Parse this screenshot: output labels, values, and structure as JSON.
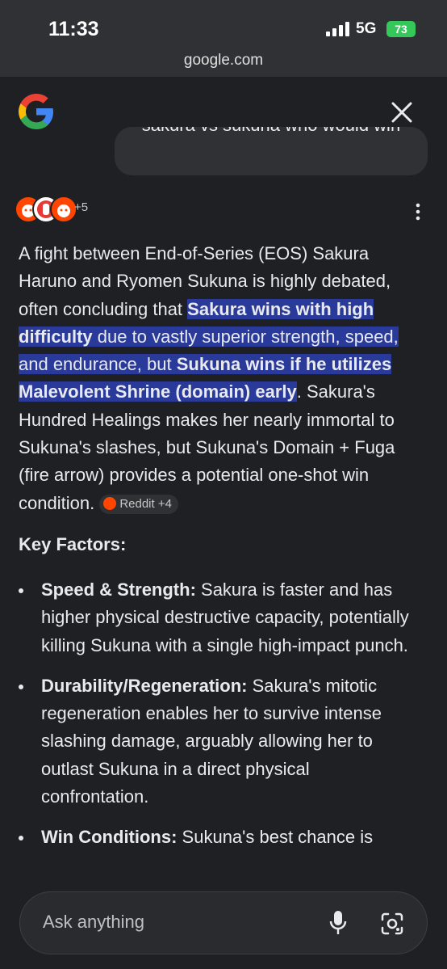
{
  "status": {
    "time": "11:33",
    "network": "5G",
    "battery": "73"
  },
  "browser": {
    "url": "google.com"
  },
  "query": "sakura vs sukuna who would win",
  "sources": {
    "more": "+5"
  },
  "answer": {
    "p1": "A fight between End-of-Series (EOS) Sakura Haruno and Ryomen Sukuna is highly debated, often concluding that ",
    "h1_bold": "Sakura wins with high difficulty",
    "h1_rest": " due to vastly superior strength, speed, and endurance, but ",
    "h2_bold": "Sukuna wins if he utilizes Malevolent Shrine (domain) early",
    "p2": ". Sakura's Hundred Healings makes her nearly immortal to Sukuna's slashes, but Sukuna's Domain + Fuga (fire arrow) provides a potential one-shot win condition.",
    "chip": "Reddit +4"
  },
  "key_factors": {
    "title": "Key Factors:",
    "items": [
      {
        "label": "Speed & Strength:",
        "text": " Sakura is faster and has higher physical destructive capacity, potentially killing Sukuna with a single high-impact punch."
      },
      {
        "label": "Durability/Regeneration:",
        "text": " Sakura's mitotic regeneration enables her to survive intense slashing damage, arguably allowing her to outlast Sukuna in a direct physical confrontation."
      },
      {
        "label": "Win Conditions:",
        "text": " Sukuna's best chance is"
      }
    ]
  },
  "ask": {
    "placeholder": "Ask anything"
  },
  "colors": {
    "background": "#1f2023",
    "highlight": "#2a3a9a",
    "reddit": "#ff4500",
    "battery": "#34c759"
  }
}
